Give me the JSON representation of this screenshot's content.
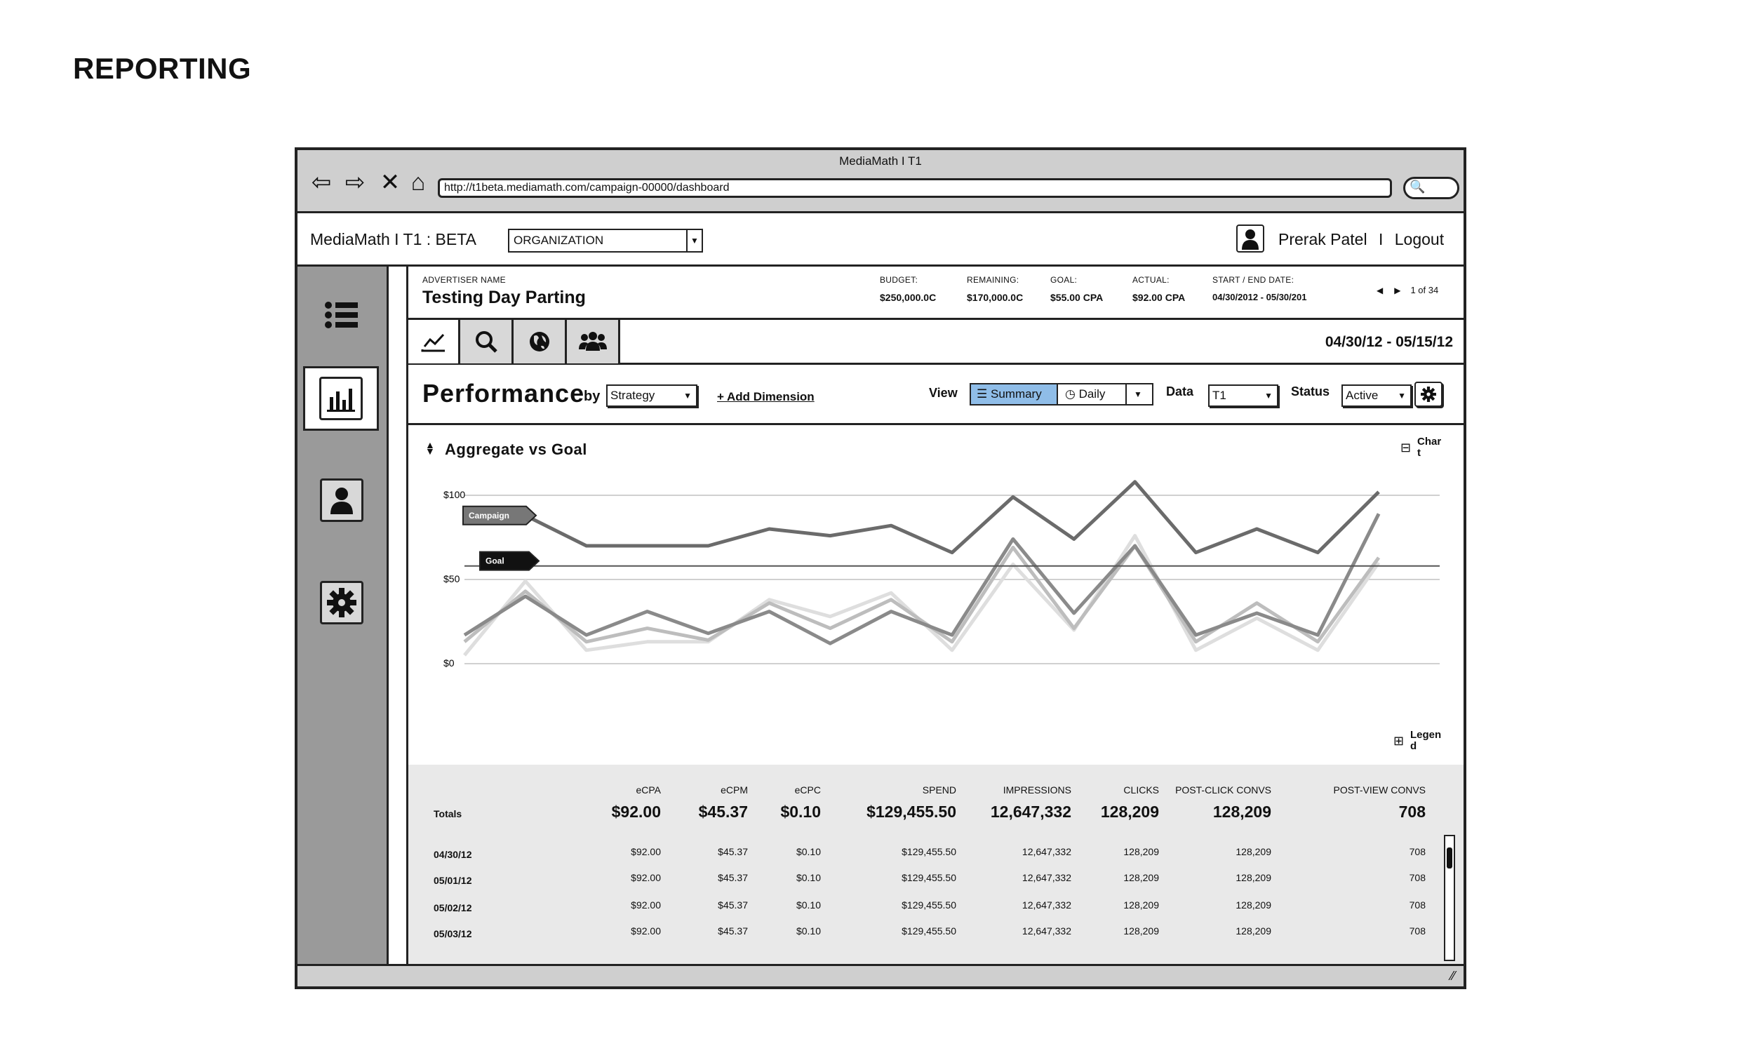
{
  "page_heading": "REPORTING",
  "browser": {
    "title": "MediaMath I T1",
    "url": "http://t1beta.mediamath.com/campaign-00000/dashboard"
  },
  "header": {
    "brand": "MediaMath  I  T1 : BETA",
    "org_select": "ORGANIZATION",
    "user_name": "Prerak Patel",
    "separator": "I",
    "logout": "Logout"
  },
  "advertiser": {
    "name_label": "ADVERTISER NAME",
    "name": "Testing Day Parting",
    "budget_label": "BUDGET:",
    "budget": "$250,000.0C",
    "remaining_label": "REMAINING:",
    "remaining": "$170,000.0C",
    "goal_label": "GOAL:",
    "goal": "$55.00 CPA",
    "actual_label": "ACTUAL:",
    "actual": "$92.00 CPA",
    "dates_label": "START / END DATE:",
    "dates": "04/30/2012 - 05/30/201",
    "pager": "1 of 34"
  },
  "tabs": {
    "date_range": "04/30/12 - 05/15/12"
  },
  "performance": {
    "title": "Performance",
    "by": "by",
    "dimension": "Strategy",
    "add_dimension": "+ Add Dimension",
    "view_label": "View",
    "summary": "Summary",
    "daily": "Daily",
    "data_label": "Data",
    "data_value": "T1",
    "status_label": "Status",
    "status_value": "Active"
  },
  "chart_section": {
    "title": "Aggregate vs Goal",
    "chart_toggle": "Char\nt",
    "legend_toggle": "Legen\nd"
  },
  "chart_data": {
    "type": "line",
    "ylim": [
      0,
      100
    ],
    "y_ticks": [
      "$0",
      "$50",
      "$100"
    ],
    "x": [
      0,
      1,
      2,
      3,
      4,
      5,
      6,
      7,
      8,
      9,
      10,
      11,
      12,
      13,
      14,
      15,
      16
    ],
    "series": [
      {
        "name": "Campaign",
        "color": "#6b6b6b",
        "values": [
          88,
          88,
          70,
          70,
          70,
          80,
          76,
          82,
          66,
          99,
          74,
          108,
          66,
          80,
          66,
          102,
          null
        ]
      },
      {
        "name": "Goal",
        "color": "#555555",
        "values": [
          58,
          58,
          58,
          58,
          58,
          58,
          58,
          58,
          58,
          58,
          58,
          58,
          58,
          58,
          58,
          58,
          58
        ]
      },
      {
        "color": "#8a8a8a",
        "values": [
          17,
          40,
          17,
          31,
          18,
          31,
          12,
          31,
          17,
          74,
          30,
          70,
          17,
          30,
          17,
          89,
          null
        ]
      },
      {
        "color": "#bdbdbd",
        "values": [
          13,
          43,
          13,
          21,
          14,
          36,
          21,
          38,
          13,
          69,
          21,
          70,
          13,
          36,
          13,
          63,
          null
        ]
      },
      {
        "color": "#dedede",
        "values": [
          5,
          49,
          8,
          13,
          13,
          38,
          28,
          42,
          8,
          59,
          20,
          76,
          8,
          27,
          8,
          60,
          null
        ]
      }
    ],
    "tags": [
      "Campaign",
      "Goal"
    ]
  },
  "totals": {
    "label": "Totals",
    "columns": [
      "eCPA",
      "eCPM",
      "eCPC",
      "SPEND",
      "IMPRESSIONS",
      "CLICKS",
      "POST-CLICK CONVS",
      "POST-VIEW CONVS"
    ],
    "values": [
      "$92.00",
      "$45.37",
      "$0.10",
      "$129,455.50",
      "12,647,332",
      "128,209",
      "128,209",
      "708"
    ],
    "rows": [
      {
        "date": "04/30/12",
        "cells": [
          "$92.00",
          "$45.37",
          "$0.10",
          "$129,455.50",
          "12,647,332",
          "128,209",
          "128,209",
          "708"
        ]
      },
      {
        "date": "05/01/12",
        "cells": [
          "$92.00",
          "$45.37",
          "$0.10",
          "$129,455.50",
          "12,647,332",
          "128,209",
          "128,209",
          "708"
        ]
      },
      {
        "date": "05/02/12",
        "cells": [
          "$92.00",
          "$45.37",
          "$0.10",
          "$129,455.50",
          "12,647,332",
          "128,209",
          "128,209",
          "708"
        ]
      },
      {
        "date": "05/03/12",
        "cells": [
          "$92.00",
          "$45.37",
          "$0.10",
          "$129,455.50",
          "12,647,332",
          "128,209",
          "128,209",
          "708"
        ]
      }
    ]
  }
}
